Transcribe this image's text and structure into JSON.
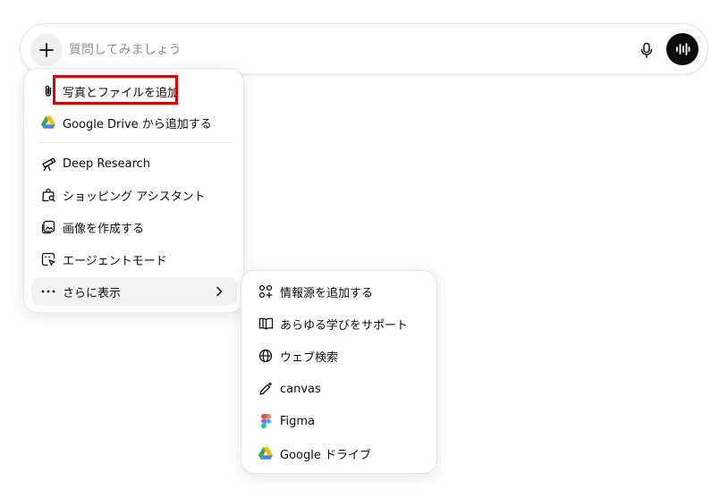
{
  "composer": {
    "placeholder": "質問してみましょう"
  },
  "main_menu": {
    "items": [
      {
        "label": "写真とファイルを追加",
        "icon": "paperclip-icon"
      },
      {
        "label": "Google Drive から追加する",
        "icon": "google-drive-icon"
      },
      {
        "label": "Deep Research",
        "icon": "telescope-icon"
      },
      {
        "label": "ショッピング アシスタント",
        "icon": "shopping-bag-search-icon"
      },
      {
        "label": "画像を作成する",
        "icon": "image-create-icon"
      },
      {
        "label": "エージェントモード",
        "icon": "agent-cursor-icon"
      },
      {
        "label": "さらに表示",
        "icon": "more-dots-icon"
      }
    ]
  },
  "sub_menu": {
    "items": [
      {
        "label": "情報源を追加する",
        "icon": "connectors-icon"
      },
      {
        "label": "あらゆる学びをサポート",
        "icon": "book-icon"
      },
      {
        "label": "ウェブ検索",
        "icon": "globe-icon"
      },
      {
        "label": "canvas",
        "icon": "pen-sparkle-icon"
      },
      {
        "label": "Figma",
        "icon": "figma-icon"
      },
      {
        "label": "Google ドライブ",
        "icon": "google-drive-icon"
      }
    ]
  },
  "colors": {
    "highlight": "#e00000",
    "voice_button": "#0d0d0d",
    "hover_row": "#f3f3f3"
  }
}
